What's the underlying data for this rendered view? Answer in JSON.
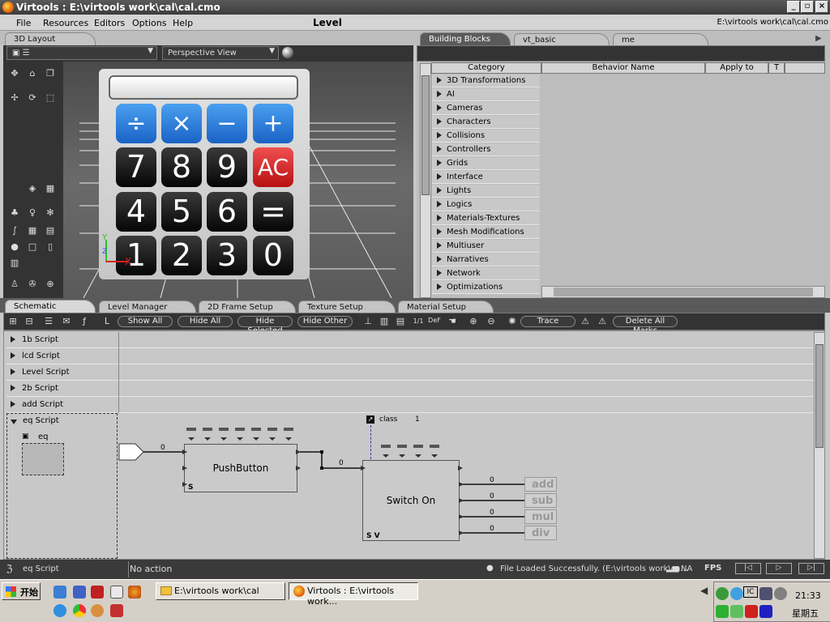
{
  "window": {
    "title": "Virtools : E:\\virtools work\\cal\\cal.cmo",
    "controls": [
      "_",
      "▫",
      "×"
    ]
  },
  "menu": {
    "items": [
      "File",
      "Resources",
      "Editors",
      "Options",
      "Help"
    ],
    "center_label": "Level",
    "file_path": "E:\\virtools work\\cal\\cal.cmo"
  },
  "layout3d": {
    "tab": "3D Layout",
    "view": "Perspective View",
    "axes": {
      "x": "X",
      "y": "Y",
      "z": "Z"
    }
  },
  "calculator": {
    "ops": [
      "÷",
      "×",
      "−",
      "+"
    ],
    "rows": [
      [
        "7",
        "8",
        "9",
        "AC"
      ],
      [
        "4",
        "5",
        "6",
        "="
      ],
      [
        "1",
        "2",
        "3",
        "0"
      ]
    ]
  },
  "building_blocks": {
    "tabs": [
      "Building Blocks",
      "vt_basic",
      "me"
    ],
    "columns": [
      "Category",
      "Behavior Name",
      "Apply to",
      "T"
    ],
    "categories": [
      "3D Transformations",
      "AI",
      "Cameras",
      "Characters",
      "Collisions",
      "Controllers",
      "Grids",
      "Interface",
      "Lights",
      "Logics",
      "Materials-Textures",
      "Mesh Modifications",
      "Multiuser",
      "Narratives",
      "Network",
      "Optimizations"
    ]
  },
  "bottom_tabs": [
    "Schematic",
    "Level Manager",
    "2D Frame Setup",
    "Texture Setup",
    "Material Setup"
  ],
  "schematic_toolbar": {
    "show_all": "Show All",
    "hide_all": "Hide All",
    "hide_selected": "Hide Selected",
    "hide_other": "Hide Other",
    "trace": "Trace",
    "delete_marks": "Delete All Marks",
    "l_label": "L",
    "ratio": "1/1",
    "def": "DeF"
  },
  "scripts": [
    "1b Script",
    "lcd Script",
    "Level Script",
    "2b Script",
    "add Script",
    "eq Script"
  ],
  "eq_script": {
    "sub_label": "eq"
  },
  "graph": {
    "pushbutton": {
      "name": "PushButton",
      "s": "S"
    },
    "switch": {
      "name": "Switch On Parameter",
      "sv": "S V"
    },
    "param": {
      "name": "class",
      "value": "1"
    },
    "wire_values": [
      "0",
      "0",
      "0",
      "0",
      "0",
      "0"
    ],
    "outputs": [
      "add",
      "sub",
      "mul",
      "div"
    ]
  },
  "status": {
    "left": "eq Script",
    "action": "No action",
    "message": "File Loaded Successfully. (E:\\virtools work\\ca...",
    "na": "NA",
    "fps": "FPS"
  },
  "taskbar": {
    "start": "开始",
    "tasks": [
      "E:\\virtools work\\cal",
      "Virtools : E:\\virtools work..."
    ],
    "time": "21:33",
    "day": "星期五"
  }
}
